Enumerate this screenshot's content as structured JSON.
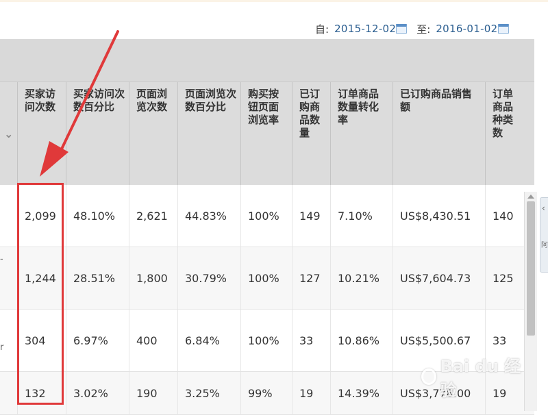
{
  "date_range": {
    "from_label": "自:",
    "from_value": "2015-12-02",
    "to_label": "至:",
    "to_value": "2016-01-02",
    "calendar_icon": "calendar-icon"
  },
  "table": {
    "headers": [
      "",
      "买家访问次数",
      "买家访问次数百分比",
      "页面浏览次数",
      "页面浏览次数百分比",
      "购买按钮页面浏览率",
      "已订购商品数量",
      "订单商品数量转化率",
      "已订购商品销售额",
      "订单商品种类数"
    ],
    "rows": [
      [
        "",
        "2,099",
        "48.10%",
        "2,621",
        "44.83%",
        "100%",
        "149",
        "7.10%",
        "US$8,430.51",
        "140"
      ],
      [
        "-",
        "1,244",
        "28.51%",
        "1,800",
        "30.79%",
        "100%",
        "127",
        "10.21%",
        "US$7,604.73",
        "125"
      ],
      [
        "r",
        "304",
        "6.97%",
        "400",
        "6.84%",
        "100%",
        "33",
        "10.86%",
        "US$5,500.67",
        "33"
      ],
      [
        "",
        "132",
        "3.02%",
        "190",
        "3.25%",
        "99%",
        "19",
        "14.39%",
        "US$3,778.00",
        "19"
      ]
    ]
  },
  "side_tab": {
    "text": "阿"
  },
  "watermark": {
    "text": "Bai du 经验"
  },
  "colors": {
    "header_bg": "#dcdcdc",
    "highlight_red": "#e0393a",
    "date_blue": "#2a5d8f"
  }
}
